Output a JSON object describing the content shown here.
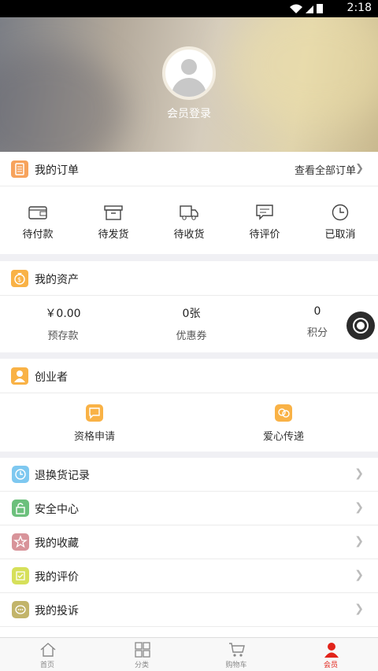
{
  "status_bar": {
    "time": "2:18"
  },
  "header": {
    "login_label": "会员登录"
  },
  "orders": {
    "title": "我的订单",
    "view_all": "查看全部订单",
    "items": [
      {
        "label": "待付款",
        "icon": "wallet-icon"
      },
      {
        "label": "待发货",
        "icon": "box-icon"
      },
      {
        "label": "待收货",
        "icon": "truck-icon"
      },
      {
        "label": "待评价",
        "icon": "comment-icon"
      },
      {
        "label": "已取消",
        "icon": "clock-icon"
      }
    ]
  },
  "assets": {
    "title": "我的资产",
    "items": [
      {
        "value": "￥0.00",
        "label": "预存款"
      },
      {
        "value": "0张",
        "label": "优惠券"
      },
      {
        "value": "0",
        "label": "积分"
      }
    ]
  },
  "entrepreneur": {
    "title": "创业者",
    "items": [
      {
        "label": "资格申请",
        "icon": "application-icon"
      },
      {
        "label": "爱心传递",
        "icon": "love-share-icon"
      }
    ]
  },
  "menu": [
    {
      "label": "退换货记录",
      "icon": "clock-icon",
      "color": "#7ec8f0"
    },
    {
      "label": "安全中心",
      "icon": "lock-icon",
      "color": "#6cc07c"
    },
    {
      "label": "我的收藏",
      "icon": "star-icon",
      "color": "#d8949a"
    },
    {
      "label": "我的评价",
      "icon": "review-icon",
      "color": "#d6e05a"
    },
    {
      "label": "我的投诉",
      "icon": "chat-icon",
      "color": "#c2b46a"
    }
  ],
  "tabs": [
    {
      "label": "首页",
      "icon": "home-icon"
    },
    {
      "label": "分类",
      "icon": "grid-icon"
    },
    {
      "label": "购物车",
      "icon": "cart-icon"
    },
    {
      "label": "会员",
      "icon": "member-icon",
      "active": true
    }
  ],
  "colors": {
    "accent": "#e2231a",
    "order_icon": "#f7a35c",
    "asset_icon": "#f9b246"
  }
}
